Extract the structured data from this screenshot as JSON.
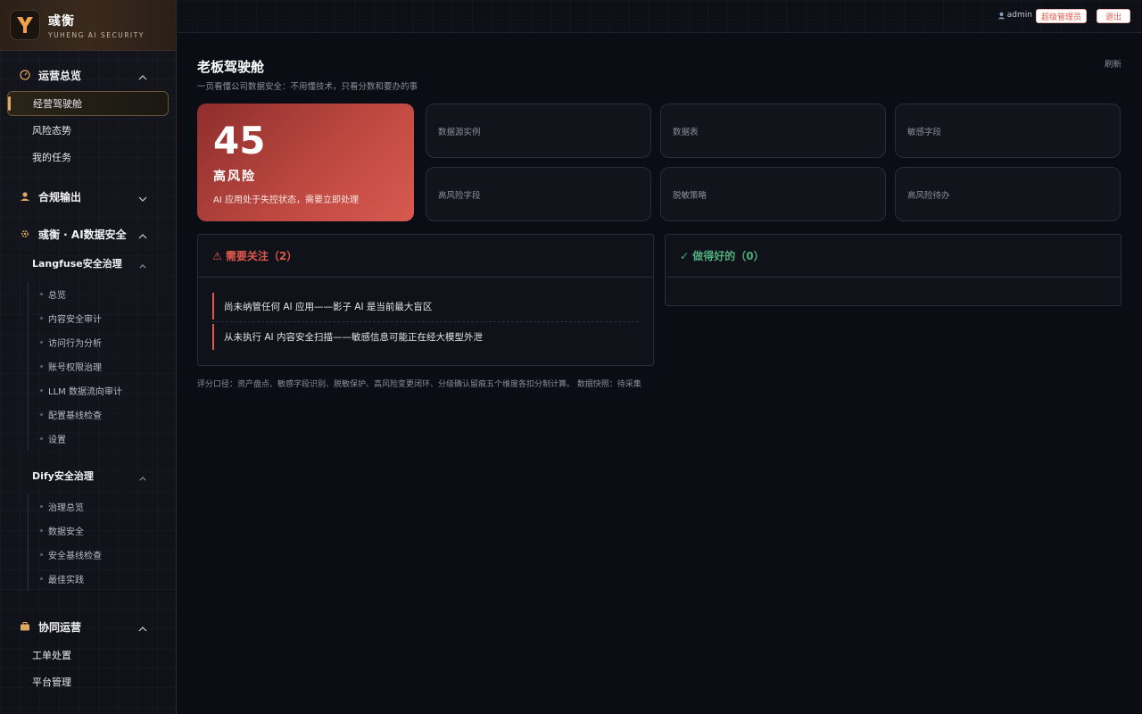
{
  "brand": {
    "name": "彧衡",
    "subtitle": "YUHENG AI SECURITY"
  },
  "sidebar": {
    "groups": [
      {
        "label": "运营总览",
        "icon": "gauge-icon",
        "expanded": true,
        "items": [
          "经营驾驶舱",
          "风险态势",
          "我的任务"
        ]
      },
      {
        "label": "合规输出",
        "icon": "user-icon",
        "expanded": false
      },
      {
        "label": "彧衡 · AI数据安全",
        "icon": "gear-icon",
        "expanded": true
      },
      {
        "label": "协同运营",
        "icon": "briefcase-icon",
        "expanded": true,
        "items": [
          "工单处置",
          "平台管理"
        ]
      }
    ],
    "langfuse": {
      "label": "Langfuse安全治理",
      "items": [
        "总览",
        "内容安全审计",
        "访问行为分析",
        "账号权限治理",
        "LLM 数据流向审计",
        "配置基线检查",
        "设置"
      ]
    },
    "dify": {
      "label": "Dify安全治理",
      "items": [
        "治理总览",
        "数据安全",
        "安全基线检查",
        "最佳实践"
      ]
    },
    "active_item": "经营驾驶舱"
  },
  "topbar": {
    "username": "admin",
    "role": "超级管理员",
    "logout": "退出"
  },
  "page": {
    "title": "老板驾驶舱",
    "subtitle": "一页看懂公司数据安全：不用懂技术，只看分数和要办的事",
    "refresh": "刷新"
  },
  "risk": {
    "score": "45",
    "level": "高风险",
    "description": "AI 应用处于失控状态，需要立即处理",
    "color": "#c04a42"
  },
  "stats": [
    "数据源实例",
    "数据表",
    "敏感字段",
    "高风险字段",
    "脱敏策略",
    "高风险待办"
  ],
  "attention": {
    "title": "⚠ 需要关注（2）",
    "items": [
      "尚未纳管任何 AI 应用——影子 AI 是当前最大盲区",
      "从未执行 AI 内容安全扫描——敏感信息可能正在经大模型外泄"
    ]
  },
  "good": {
    "title": "✓ 做得好的（0）"
  },
  "footnote": "评分口径：资产盘点、敏感字段识别、脱敏保护、高风险变更闭环、分级确认留痕五个维度各扣分制计算。 数据快照：待采集",
  "colors": {
    "accent": "#e0a860",
    "danger": "#e0584a",
    "success": "#4fae7c",
    "background": "#0b0d14"
  }
}
